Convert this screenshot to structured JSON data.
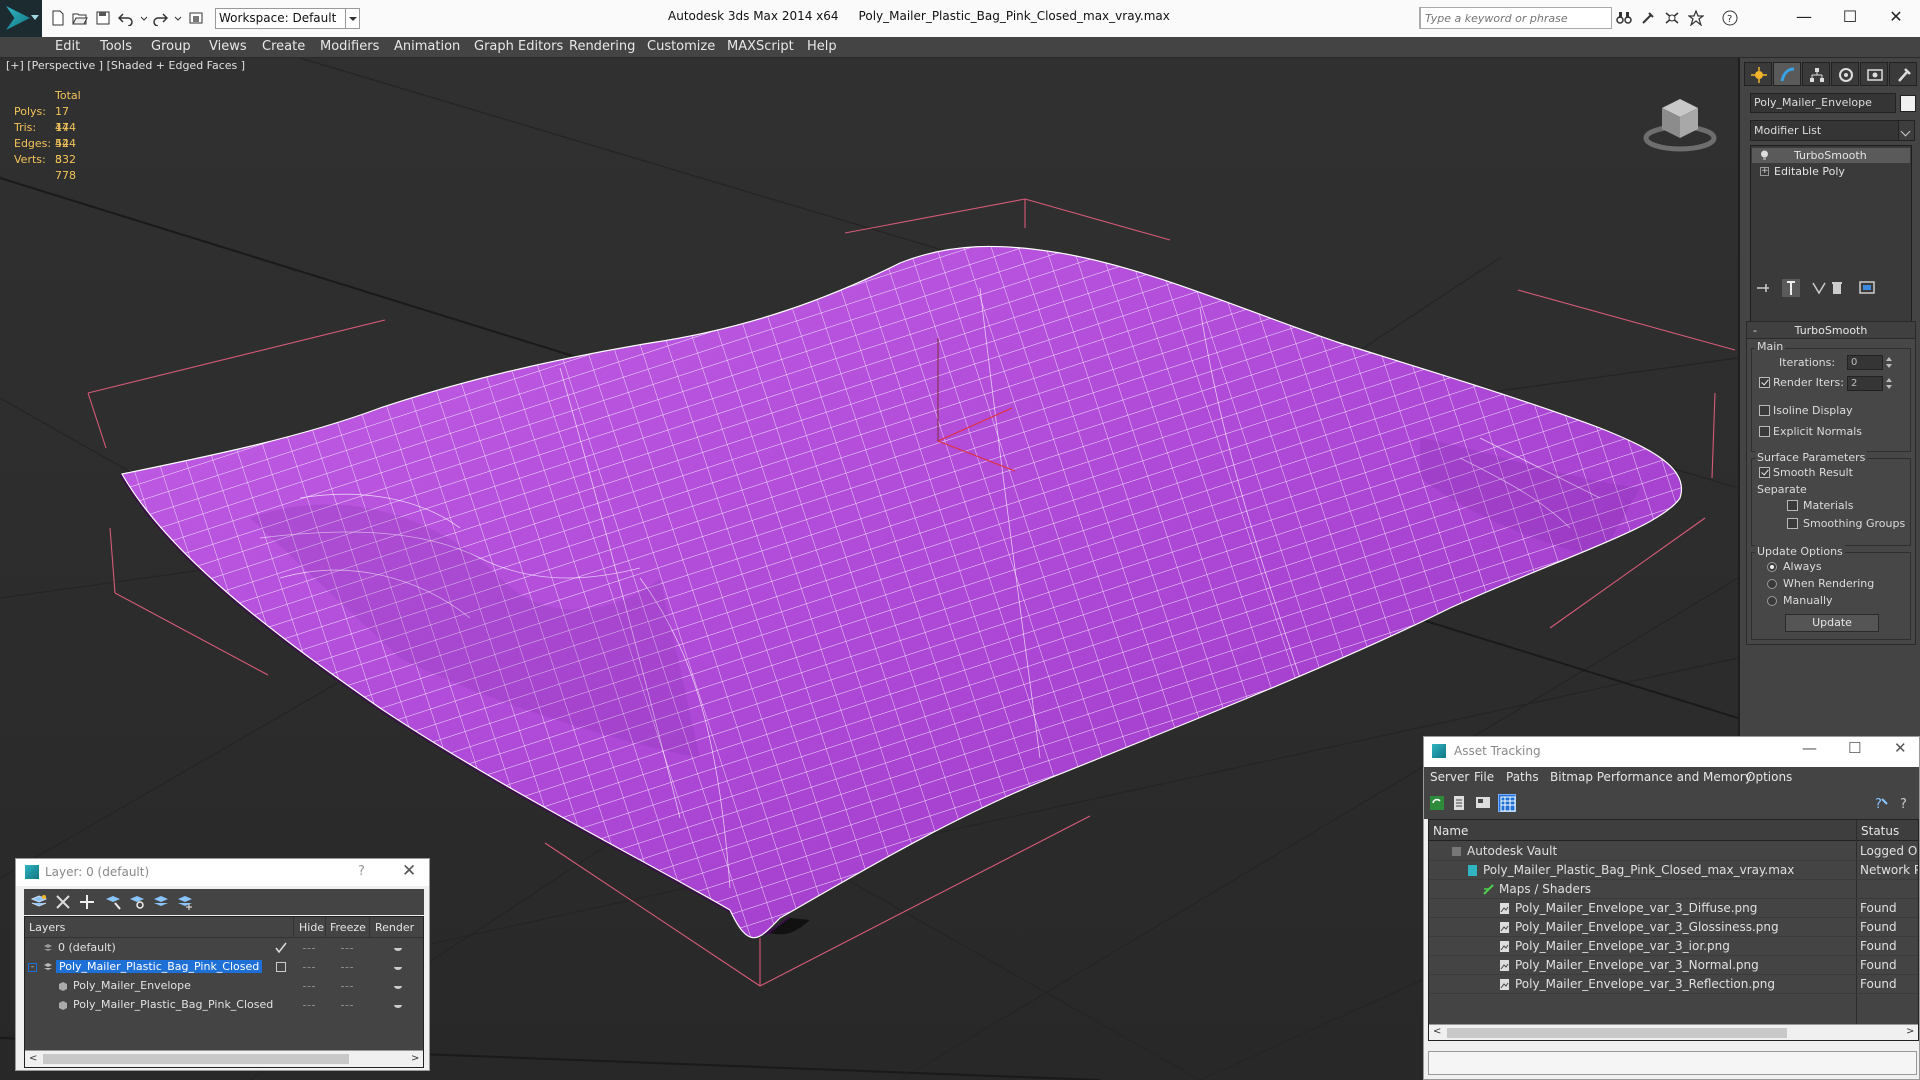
{
  "titlebar": {
    "app_title": "Autodesk 3ds Max  2014 x64",
    "file_name": "Poly_Mailer_Plastic_Bag_Pink_Closed_max_vray.max",
    "workspace": "Workspace: Default",
    "search_placeholder": "Type a keyword or phrase",
    "minimize": "—",
    "maximize": "☐",
    "close": "✕"
  },
  "menu": [
    "Edit",
    "Tools",
    "Group",
    "Views",
    "Create",
    "Modifiers",
    "Animation",
    "Graph Editors",
    "Rendering",
    "Customize",
    "MAXScript",
    "Help"
  ],
  "viewport": {
    "label": "[+] [Perspective ] [Shaded + Edged Faces ]",
    "stats": {
      "header": "Total",
      "rows": [
        {
          "key": "Polys:",
          "value": "17 444"
        },
        {
          "key": "Tris:",
          "value": "17 444"
        },
        {
          "key": "Edges:",
          "value": "52 332"
        },
        {
          "key": "Verts:",
          "value": "8 778"
        }
      ]
    },
    "mesh_color": "#b250d8",
    "wire_color": "#ffffff",
    "bbox_color": "#d65a78"
  },
  "command_panel": {
    "object_name": "Poly_Mailer_Envelope",
    "modifier_list": "Modifier List",
    "stack": [
      "TurboSmooth",
      "Editable Poly"
    ],
    "turbosmooth": {
      "title": "TurboSmooth",
      "main_label": "Main",
      "iterations_label": "Iterations:",
      "iterations": "0",
      "render_iters_label": "Render Iters:",
      "render_iters": "2",
      "isoline_display": "Isoline Display",
      "explicit_normals": "Explicit Normals",
      "surface_params": "Surface Parameters",
      "smooth_result": "Smooth Result",
      "separate": "Separate",
      "materials": "Materials",
      "smoothing_groups": "Smoothing Groups",
      "update_options": "Update Options",
      "always": "Always",
      "when_rendering": "When Rendering",
      "manually": "Manually",
      "update_button": "Update"
    }
  },
  "layer_dialog": {
    "title": "Layer: 0 (default)",
    "help": "?",
    "close": "✕",
    "columns": {
      "layers": "Layers",
      "hide": "Hide",
      "freeze": "Freeze",
      "render": "Render"
    },
    "rows": [
      {
        "name": "0 (default)"
      },
      {
        "name": "Poly_Mailer_Plastic_Bag_Pink_Closed"
      },
      {
        "name": "Poly_Mailer_Envelope"
      },
      {
        "name": "Poly_Mailer_Plastic_Bag_Pink_Closed"
      }
    ]
  },
  "asset_tracking": {
    "title": "Asset Tracking",
    "menu": [
      "Server",
      "File",
      "Paths",
      "Bitmap Performance and Memory",
      "Options"
    ],
    "columns": {
      "name": "Name",
      "status": "Status"
    },
    "rows": [
      {
        "name": "Autodesk Vault",
        "status": "Logged Out"
      },
      {
        "name": "Poly_Mailer_Plastic_Bag_Pink_Closed_max_vray.max",
        "status": "Network Path"
      },
      {
        "name": "Maps / Shaders",
        "status": ""
      },
      {
        "name": "Poly_Mailer_Envelope_var_3_Diffuse.png",
        "status": "Found"
      },
      {
        "name": "Poly_Mailer_Envelope_var_3_Glossiness.png",
        "status": "Found"
      },
      {
        "name": "Poly_Mailer_Envelope_var_3_ior.png",
        "status": "Found"
      },
      {
        "name": "Poly_Mailer_Envelope_var_3_Normal.png",
        "status": "Found"
      },
      {
        "name": "Poly_Mailer_Envelope_var_3_Reflection.png",
        "status": "Found"
      }
    ]
  }
}
